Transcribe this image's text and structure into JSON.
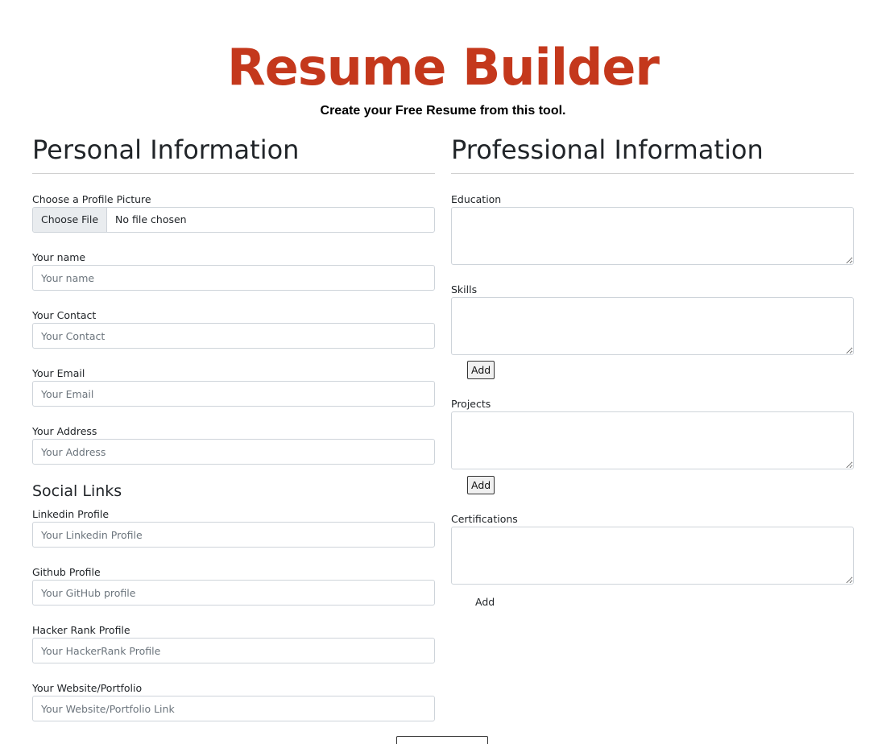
{
  "header": {
    "title": "Resume Builder",
    "subtitle": "Create your Free Resume from this tool."
  },
  "personal": {
    "heading": "Personal Information",
    "profile_picture": {
      "label": "Choose a Profile Picture",
      "button": "Choose File",
      "status": "No file chosen"
    },
    "fields": [
      {
        "label": "Your name",
        "placeholder": "Your name"
      },
      {
        "label": "Your Contact",
        "placeholder": "Your Contact"
      },
      {
        "label": "Your Email",
        "placeholder": "Your Email"
      },
      {
        "label": "Your Address",
        "placeholder": "Your Address"
      }
    ]
  },
  "social": {
    "heading": "Social Links",
    "fields": [
      {
        "label": "Linkedin Profile",
        "placeholder": "Your Linkedin Profile"
      },
      {
        "label": "Github Profile",
        "placeholder": "Your GitHub profile"
      },
      {
        "label": "Hacker Rank Profile",
        "placeholder": "Your HackerRank Profile"
      },
      {
        "label": "Your Website/Portfolio",
        "placeholder": "Your Website/Portfolio Link"
      }
    ]
  },
  "professional": {
    "heading": "Professional Information",
    "education": {
      "label": "Education"
    },
    "skills": {
      "label": "Skills",
      "add": "Add"
    },
    "projects": {
      "label": "Projects",
      "add": "Add"
    },
    "certifications": {
      "label": "Certifications",
      "add": "Add"
    }
  },
  "colors": {
    "title": "#c4381c",
    "border": "#ced4da",
    "file_button_bg": "#e9ecef"
  }
}
